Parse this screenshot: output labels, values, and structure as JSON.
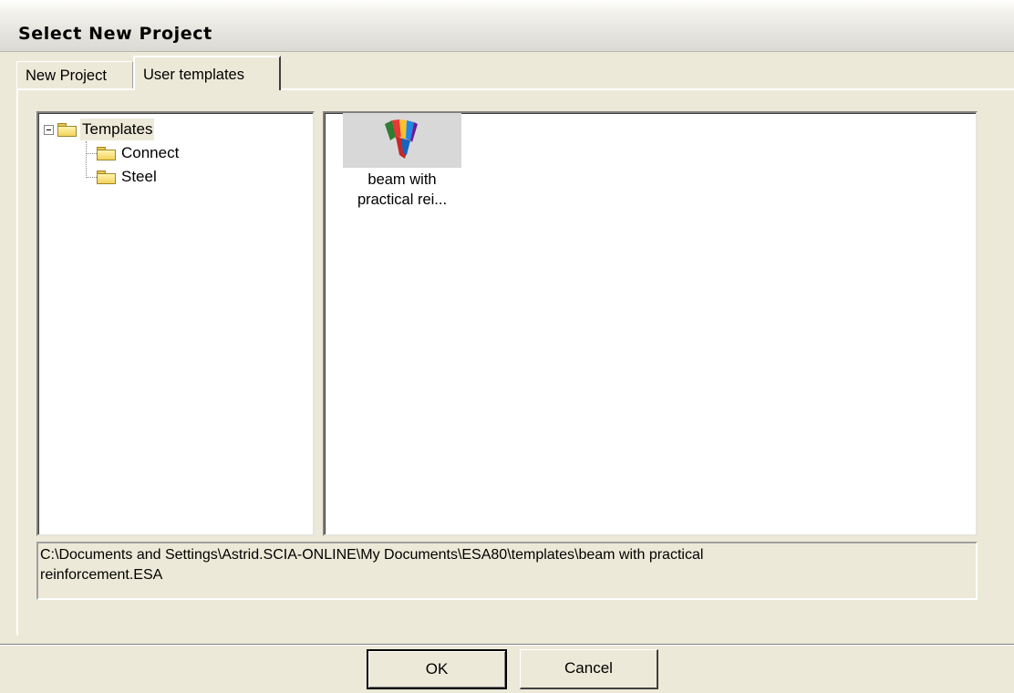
{
  "window": {
    "title": "Select New Project"
  },
  "tabs": [
    {
      "label": "New Project",
      "active": false
    },
    {
      "label": "User templates",
      "active": true
    }
  ],
  "tree": {
    "root": {
      "label": "Templates",
      "expanded": true,
      "icon": "folder-icon"
    },
    "children": [
      {
        "label": "Connect",
        "icon": "folder-icon"
      },
      {
        "label": "Steel",
        "icon": "folder-icon"
      }
    ]
  },
  "files": [
    {
      "label_line1": "beam with",
      "label_line2": "practical rei...",
      "icon": "project-template-icon"
    }
  ],
  "path": {
    "line1": "C:\\Documents and Settings\\Astrid.SCIA-ONLINE\\My Documents\\ESA80\\templates\\beam with practical",
    "line2": "reinforcement.ESA"
  },
  "buttons": {
    "ok": "OK",
    "cancel": "Cancel"
  }
}
